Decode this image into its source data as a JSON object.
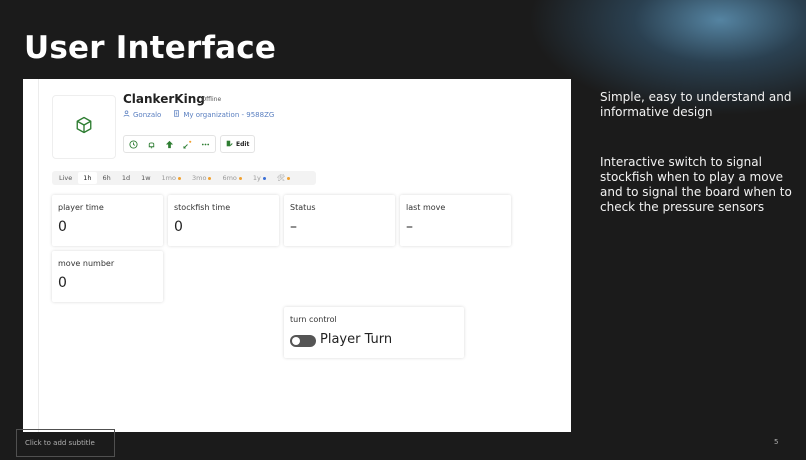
{
  "slide": {
    "title": "User Interface",
    "bullet_1": "Simple, easy to understand and informative design",
    "bullet_2": "Interactive switch to signal stockfish when to play a move and to signal the board when to check the pressure sensors",
    "subtitle_placeholder": "Click to add subtitle",
    "page_number": "5"
  },
  "device": {
    "name": "ClankerKing",
    "status": "Offline",
    "owner": "Gonzalo",
    "organization": "My organization - 9588ZG",
    "edit_label": "Edit",
    "icons": [
      "clock-icon",
      "bell-icon",
      "share-icon",
      "add-widget-icon",
      "more-icon"
    ]
  },
  "time_range": {
    "tabs": [
      {
        "label": "Live"
      },
      {
        "label": "1h"
      },
      {
        "label": "6h"
      },
      {
        "label": "1d"
      },
      {
        "label": "1w"
      },
      {
        "label": "1mo"
      },
      {
        "label": "3mo"
      },
      {
        "label": "6mo"
      },
      {
        "label": "1y"
      },
      {
        "label": "🛠"
      }
    ],
    "selected": "1h",
    "colors": {
      "premium_dot": "#f0a030",
      "blue_dot": "#3b6fd6"
    }
  },
  "widgets": {
    "player_time": {
      "label": "player time",
      "value": "0"
    },
    "stockfish_time": {
      "label": "stockfish time",
      "value": "0"
    },
    "status": {
      "label": "Status",
      "value": "–"
    },
    "last_move": {
      "label": "last move",
      "value": "–"
    },
    "move_number": {
      "label": "move number",
      "value": "0"
    },
    "turn_control": {
      "label": "turn control",
      "switch_label": "Player Turn",
      "switch_on": false
    }
  },
  "colors": {
    "accent": "#2e7d32",
    "link": "#5a7fc0",
    "background": "#1b1b1b"
  }
}
